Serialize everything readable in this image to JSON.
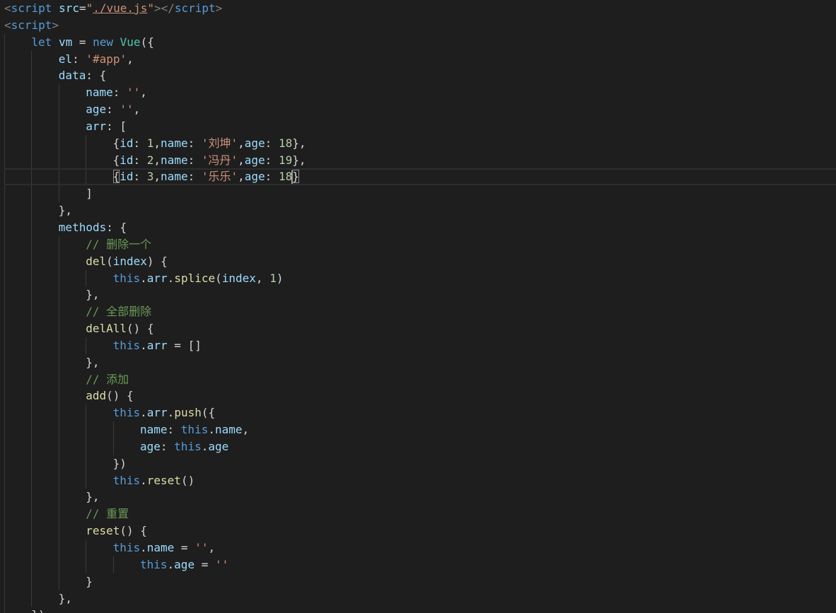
{
  "editor": {
    "language": "html",
    "current_line": 10,
    "lines": [
      {
        "indent": 0,
        "tokens": [
          [
            "<",
            "punct"
          ],
          [
            "script",
            "tag"
          ],
          [
            " ",
            "text"
          ],
          [
            "src",
            "attr"
          ],
          [
            "=",
            "text"
          ],
          [
            "\"",
            "str"
          ],
          [
            "./vue.js",
            "link"
          ],
          [
            "\"",
            "str"
          ],
          [
            "></",
            "punct"
          ],
          [
            "script",
            "tag"
          ],
          [
            ">",
            "punct"
          ]
        ]
      },
      {
        "indent": 0,
        "tokens": [
          [
            "<",
            "punct"
          ],
          [
            "script",
            "tag"
          ],
          [
            ">",
            "punct"
          ]
        ]
      },
      {
        "indent": 1,
        "tokens": [
          [
            "let",
            "kw"
          ],
          [
            " ",
            "text"
          ],
          [
            "vm",
            "var"
          ],
          [
            " = ",
            "text"
          ],
          [
            "new",
            "kw"
          ],
          [
            " ",
            "text"
          ],
          [
            "Vue",
            "class"
          ],
          [
            "({",
            "text"
          ]
        ]
      },
      {
        "indent": 2,
        "tokens": [
          [
            "el",
            "prop"
          ],
          [
            ": ",
            "text"
          ],
          [
            "'#app'",
            "str"
          ],
          [
            ",",
            "text"
          ]
        ]
      },
      {
        "indent": 2,
        "tokens": [
          [
            "data",
            "prop"
          ],
          [
            ": {",
            "text"
          ]
        ]
      },
      {
        "indent": 3,
        "tokens": [
          [
            "name",
            "prop"
          ],
          [
            ": ",
            "text"
          ],
          [
            "''",
            "str"
          ],
          [
            ",",
            "text"
          ]
        ]
      },
      {
        "indent": 3,
        "tokens": [
          [
            "age",
            "prop"
          ],
          [
            ": ",
            "text"
          ],
          [
            "''",
            "str"
          ],
          [
            ",",
            "text"
          ]
        ]
      },
      {
        "indent": 3,
        "tokens": [
          [
            "arr",
            "prop"
          ],
          [
            ": [",
            "text"
          ]
        ]
      },
      {
        "indent": 4,
        "tokens": [
          [
            "{",
            "text"
          ],
          [
            "id",
            "prop"
          ],
          [
            ": ",
            "text"
          ],
          [
            "1",
            "num"
          ],
          [
            ",",
            "text"
          ],
          [
            "name",
            "prop"
          ],
          [
            ": ",
            "text"
          ],
          [
            "'刘坤'",
            "str"
          ],
          [
            ",",
            "text"
          ],
          [
            "age",
            "prop"
          ],
          [
            ": ",
            "text"
          ],
          [
            "18",
            "num"
          ],
          [
            "},",
            "text"
          ]
        ]
      },
      {
        "indent": 4,
        "tokens": [
          [
            "{",
            "text"
          ],
          [
            "id",
            "prop"
          ],
          [
            ": ",
            "text"
          ],
          [
            "2",
            "num"
          ],
          [
            ",",
            "text"
          ],
          [
            "name",
            "prop"
          ],
          [
            ": ",
            "text"
          ],
          [
            "'冯丹'",
            "str"
          ],
          [
            ",",
            "text"
          ],
          [
            "age",
            "prop"
          ],
          [
            ": ",
            "text"
          ],
          [
            "19",
            "num"
          ],
          [
            "},",
            "text"
          ]
        ]
      },
      {
        "indent": 4,
        "tokens": [
          [
            "{",
            "bracketbox"
          ],
          [
            "id",
            "prop"
          ],
          [
            ": ",
            "text"
          ],
          [
            "3",
            "num"
          ],
          [
            ",",
            "text"
          ],
          [
            "name",
            "prop"
          ],
          [
            ": ",
            "text"
          ],
          [
            "'乐乐'",
            "str"
          ],
          [
            ",",
            "text"
          ],
          [
            "age",
            "prop"
          ],
          [
            ": ",
            "text"
          ],
          [
            "18",
            "num"
          ],
          [
            "|",
            "cursor"
          ],
          [
            "}",
            "bracketbox"
          ]
        ]
      },
      {
        "indent": 3,
        "tokens": [
          [
            "]",
            "text"
          ]
        ]
      },
      {
        "indent": 2,
        "tokens": [
          [
            "},",
            "text"
          ]
        ]
      },
      {
        "indent": 2,
        "tokens": [
          [
            "methods",
            "prop"
          ],
          [
            ": {",
            "text"
          ]
        ]
      },
      {
        "indent": 3,
        "tokens": [
          [
            "// 删除一个",
            "comment"
          ]
        ]
      },
      {
        "indent": 3,
        "tokens": [
          [
            "del",
            "fn"
          ],
          [
            "(",
            "text"
          ],
          [
            "index",
            "var"
          ],
          [
            ") {",
            "text"
          ]
        ]
      },
      {
        "indent": 4,
        "tokens": [
          [
            "this",
            "kw"
          ],
          [
            ".",
            "text"
          ],
          [
            "arr",
            "prop"
          ],
          [
            ".",
            "text"
          ],
          [
            "splice",
            "fn"
          ],
          [
            "(",
            "text"
          ],
          [
            "index",
            "var"
          ],
          [
            ", ",
            "text"
          ],
          [
            "1",
            "num"
          ],
          [
            ")",
            "text"
          ]
        ]
      },
      {
        "indent": 3,
        "tokens": [
          [
            "},",
            "text"
          ]
        ]
      },
      {
        "indent": 3,
        "tokens": [
          [
            "// 全部删除",
            "comment"
          ]
        ]
      },
      {
        "indent": 3,
        "tokens": [
          [
            "delAll",
            "fn"
          ],
          [
            "() {",
            "text"
          ]
        ]
      },
      {
        "indent": 4,
        "tokens": [
          [
            "this",
            "kw"
          ],
          [
            ".",
            "text"
          ],
          [
            "arr",
            "prop"
          ],
          [
            " = []",
            "text"
          ]
        ]
      },
      {
        "indent": 3,
        "tokens": [
          [
            "},",
            "text"
          ]
        ]
      },
      {
        "indent": 3,
        "tokens": [
          [
            "// 添加",
            "comment"
          ]
        ]
      },
      {
        "indent": 3,
        "tokens": [
          [
            "add",
            "fn"
          ],
          [
            "() {",
            "text"
          ]
        ]
      },
      {
        "indent": 4,
        "tokens": [
          [
            "this",
            "kw"
          ],
          [
            ".",
            "text"
          ],
          [
            "arr",
            "prop"
          ],
          [
            ".",
            "text"
          ],
          [
            "push",
            "fn"
          ],
          [
            "({",
            "text"
          ]
        ]
      },
      {
        "indent": 5,
        "tokens": [
          [
            "name",
            "prop"
          ],
          [
            ": ",
            "text"
          ],
          [
            "this",
            "kw"
          ],
          [
            ".",
            "text"
          ],
          [
            "name",
            "prop"
          ],
          [
            ",",
            "text"
          ]
        ]
      },
      {
        "indent": 5,
        "tokens": [
          [
            "age",
            "prop"
          ],
          [
            ": ",
            "text"
          ],
          [
            "this",
            "kw"
          ],
          [
            ".",
            "text"
          ],
          [
            "age",
            "prop"
          ]
        ]
      },
      {
        "indent": 4,
        "tokens": [
          [
            "})",
            "text"
          ]
        ]
      },
      {
        "indent": 4,
        "tokens": [
          [
            "this",
            "kw"
          ],
          [
            ".",
            "text"
          ],
          [
            "reset",
            "fn"
          ],
          [
            "()",
            "text"
          ]
        ]
      },
      {
        "indent": 3,
        "tokens": [
          [
            "},",
            "text"
          ]
        ]
      },
      {
        "indent": 3,
        "tokens": [
          [
            "// 重置",
            "comment"
          ]
        ]
      },
      {
        "indent": 3,
        "tokens": [
          [
            "reset",
            "fn"
          ],
          [
            "() {",
            "text"
          ]
        ]
      },
      {
        "indent": 4,
        "tokens": [
          [
            "this",
            "kw"
          ],
          [
            ".",
            "text"
          ],
          [
            "name",
            "prop"
          ],
          [
            " = ",
            "text"
          ],
          [
            "''",
            "str"
          ],
          [
            ",",
            "text"
          ]
        ]
      },
      {
        "indent": 5,
        "tokens": [
          [
            "this",
            "kw"
          ],
          [
            ".",
            "text"
          ],
          [
            "age",
            "prop"
          ],
          [
            " = ",
            "text"
          ],
          [
            "''",
            "str"
          ]
        ]
      },
      {
        "indent": 3,
        "tokens": [
          [
            "}",
            "text"
          ]
        ]
      },
      {
        "indent": 2,
        "tokens": [
          [
            "},",
            "text"
          ]
        ]
      },
      {
        "indent": 1,
        "tokens": [
          [
            "})",
            "text"
          ]
        ]
      }
    ]
  }
}
